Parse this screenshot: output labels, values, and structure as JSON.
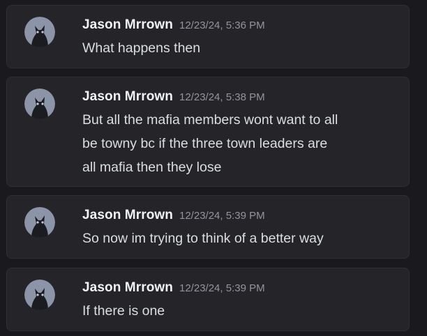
{
  "messages": [
    {
      "author": "Jason Mrrown",
      "timestamp": "12/23/24, 5:36 PM",
      "lines": [
        "What happens then"
      ]
    },
    {
      "author": "Jason Mrrown",
      "timestamp": "12/23/24, 5:38 PM",
      "lines": [
        "But all the mafia members wont want to all",
        "be towny bc if the three town leaders are",
        "all mafia then they lose"
      ]
    },
    {
      "author": "Jason Mrrown",
      "timestamp": "12/23/24, 5:39 PM",
      "lines": [
        "So now im trying to think of a better way"
      ]
    },
    {
      "author": "Jason Mrrown",
      "timestamp": "12/23/24, 5:39 PM",
      "lines": [
        "If there is one"
      ]
    }
  ],
  "colors": {
    "background": "#1a1a1e",
    "message_bg": "#242429",
    "username": "#f2f3f5",
    "timestamp": "#94959c",
    "text": "#dbdee1"
  },
  "avatar_icon": "black-cat-avatar-icon"
}
